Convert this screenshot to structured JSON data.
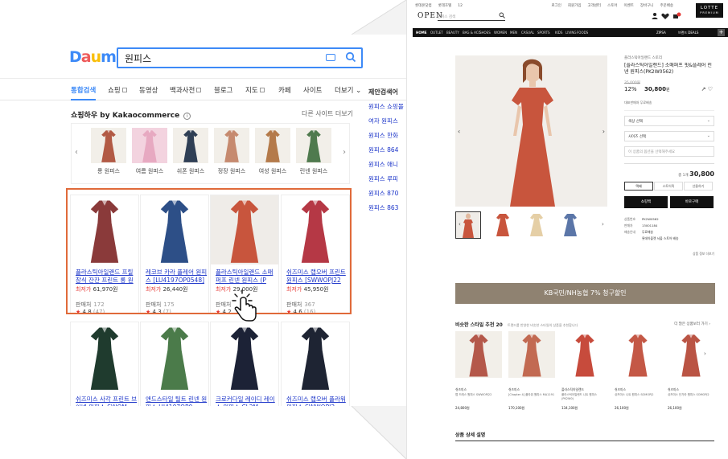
{
  "search": {
    "logo_letters": [
      "D",
      "a",
      "u",
      "m"
    ],
    "logo_colors": [
      "#3d8af7",
      "#ee5a5a",
      "#f9bf0a",
      "#3d8af7"
    ],
    "query": "원피스",
    "tabs": [
      {
        "label": "통합검색",
        "active": true,
        "box": false
      },
      {
        "label": "쇼핑",
        "box": true
      },
      {
        "label": "동영상",
        "box": false
      },
      {
        "label": "백과사전",
        "box": true
      },
      {
        "label": "블로그",
        "box": false
      },
      {
        "label": "지도",
        "box": true
      },
      {
        "label": "카페",
        "box": false
      },
      {
        "label": "사이트",
        "box": false
      },
      {
        "label": "더보기",
        "box": false
      }
    ],
    "section_title": "쇼핑하우 by Kakaocommerce",
    "section_info": "i",
    "section_more": "다른 사이트 더보기",
    "categories": [
      {
        "label": "롱 원피스",
        "color": "#b25a45"
      },
      {
        "label": "여름 원피스",
        "color": "#e7a9c1"
      },
      {
        "label": "쉬폰 원피스",
        "color": "#2f3f55"
      },
      {
        "label": "정장 원피스",
        "color": "#c68a6f"
      },
      {
        "label": "여성 원피스",
        "color": "#b47a4a"
      },
      {
        "label": "린넨 원피스",
        "color": "#4f7a4e"
      }
    ],
    "products_row1": [
      {
        "title": "플라스틱아일랜드 프릴 장식 잔잔 프린트 롱 원",
        "price_label": "최저가",
        "price": "61,970원",
        "seller_label": "판매처",
        "seller_count": "172",
        "rating": "4.8",
        "reviews": "(47)",
        "color": "#8a3a3a"
      },
      {
        "title": "레코브 카라 플레어 원피스 [LU4197OP0548]",
        "price_label": "최저가",
        "price": "26,440원",
        "seller_label": "판매처",
        "seller_count": "175",
        "rating": "4.3",
        "reviews": "(7)",
        "color": "#2d4f87"
      },
      {
        "title": "플라스틱아일랜드 소매퍼프 린넨 원피스 (P",
        "price_label": "최저가",
        "price": "29,000원",
        "seller_label": "판매처",
        "seller_count": "",
        "rating": "4.2",
        "reviews": "",
        "color": "#c8553d"
      },
      {
        "title": "쉬즈미스 랩오버 프린트 원피스 [SWWOPJ22",
        "price_label": "최저가",
        "price": "45,950원",
        "seller_label": "판매처",
        "seller_count": "367",
        "rating": "4.6",
        "reviews": "(16)",
        "color": "#b53845"
      }
    ],
    "products_row2": [
      {
        "title": "쉬즈미스 사각 프린트 브이넥 원피스 SWOM",
        "color": "#1f3b2e"
      },
      {
        "title": "앤드스타일 틸트 린넨 원피스 HI4107OP0",
        "color": "#4b7b4a"
      },
      {
        "title": "크로커다일 레이디 레이스 원피스 CL2M",
        "color": "#1c2236"
      },
      {
        "title": "쉬즈미스 랩오버 플라워 원피스 SWWOPJ2",
        "color": "#1e2433"
      }
    ],
    "suggest_title": "제안검색어",
    "suggestions": [
      "원피스 쇼핑몰",
      "여자 원피스",
      "원피스 한화",
      "원피스 864",
      "원피스 애니",
      "원피스 루피",
      "원피스 870",
      "원피스 863"
    ]
  },
  "product": {
    "util_left": [
      "롯데온닷컴",
      "롯데호텔",
      "12"
    ],
    "util_right": [
      "로그인",
      "회원가입",
      "고객센터",
      "스토어",
      "이벤트",
      "장바구니",
      "주문배송"
    ],
    "brand_logo": "OPEN",
    "search_placeholder": "원피스 검색",
    "cart_count": "0",
    "lotte_badge": "LOTTE",
    "lotte_badge_sub": "PREMIUM",
    "nav": [
      "HOME",
      "OUTLET",
      "BEAUTY",
      "BAG & ACC",
      "SHOES",
      "WOMEN",
      "MEN",
      "CASUAL",
      "SPORTS",
      "KIDS",
      "LIVING",
      "FOODS"
    ],
    "nav_right": [
      "ZIPSA",
      "브랜드 DEALS"
    ],
    "brand": "플라스틱아일랜드 스토리",
    "name": "[플라스틱아일랜드] 소매퍼프 핏&플레어 린넨 원피스(PK2W0562)",
    "original_price": "35,000원",
    "discount": "12%",
    "price": "30,800",
    "price_unit": "원",
    "meta": "대표판매처  무료배송",
    "options": [
      "색상 선택",
      "사이즈 선택",
      "이 상품의 옵션을 선택해주세요"
    ],
    "total_label": "총 1개",
    "total_price": "30,800",
    "segments": [
      "택배",
      "스토어픽",
      "선물하기"
    ],
    "buy_now": "쇼핑백",
    "buy": "바로구매",
    "info_rows": [
      {
        "k": "상품번호",
        "v": "PK2W0562"
      },
      {
        "k": "판매자",
        "v": "13001184"
      },
      {
        "k": "배송안내",
        "v": "무료배송"
      },
      {
        "k": "",
        "v": "롯데아울렛 서울 스토어 배송"
      }
    ],
    "more_info": "상품 정보 더보기",
    "promo": "KB국민/NH농협 7% 청구할인",
    "similar_title": "비슷한 스타일 추천",
    "similar_count": "20",
    "similar_sub": "트렌드를 반영한 비슷한 스타일의 상품을 추천합니다",
    "similar_more": "더 많은 상품보러 가기",
    "similar": [
      {
        "brand": "쉬즈미스",
        "name": "랩 드레스 원피스 SWWOPJ22",
        "price": "24,800원",
        "color": "#b4584a"
      },
      {
        "brand": "쉬즈미스",
        "name": "[Chapter 4] 플라워 원피스 MA1191",
        "price": "170,100원",
        "color": "#c26a52"
      },
      {
        "brand": "플라스틱아일랜드",
        "name": "플라스틱아일랜드 니트 원피스 (PK2W0)",
        "price": "134,100원",
        "color": "#c74b3c"
      },
      {
        "brand": "쉬즈미스",
        "name": "쉬즈미스 니트 원피스 SOMOPJ2",
        "price": "26,100원",
        "color": "#c45846"
      },
      {
        "brand": "쉬즈미스",
        "name": "쉬즈미스 단가라 원피스 SOMOPJ2",
        "price": "26,100원",
        "color": "#ba5444"
      }
    ],
    "detail_title": "상품 상세 설명"
  }
}
